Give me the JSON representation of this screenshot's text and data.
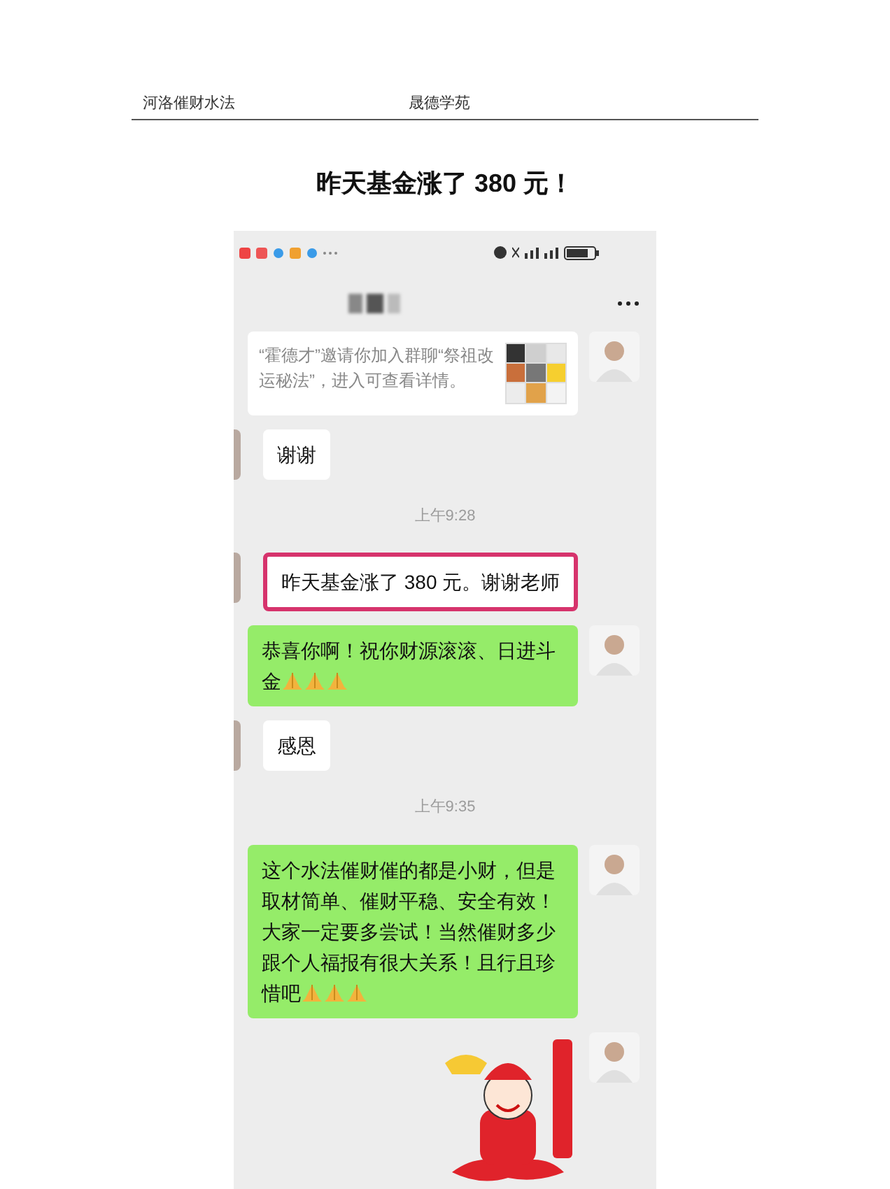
{
  "document": {
    "header_left": "河洛催财水法",
    "header_right": "晟德学苑",
    "title": "昨天基金涨了 380 元！"
  },
  "messages": [
    {
      "kind": "card",
      "outgoing": true,
      "text": "“霍德才”邀请你加入群聊“祭祖改运秘法”，进入可查看详情。"
    },
    {
      "kind": "text",
      "outgoing": false,
      "text": "谢谢",
      "highlighted": false,
      "prayer_emoji": false
    },
    {
      "kind": "time",
      "text": "上午9:28"
    },
    {
      "kind": "text",
      "outgoing": false,
      "text": "昨天基金涨了 380 元。谢谢老师",
      "highlighted": true,
      "prayer_emoji": false
    },
    {
      "kind": "text",
      "outgoing": true,
      "text": "恭喜你啊！祝你财源滚滚、日进斗金",
      "highlighted": false,
      "prayer_emoji": true
    },
    {
      "kind": "text",
      "outgoing": false,
      "text": "感恩",
      "highlighted": false,
      "prayer_emoji": false
    },
    {
      "kind": "time",
      "text": "上午9:35"
    },
    {
      "kind": "text",
      "outgoing": true,
      "text": "这个水法催财催的都是小财，但是取材简单、催财平稳、安全有效！大家一定要多尝试！当然催财多少跟个人福报有很大关系！且行且珍惜吧",
      "highlighted": false,
      "prayer_emoji": true
    },
    {
      "kind": "sticker",
      "outgoing": true
    }
  ]
}
